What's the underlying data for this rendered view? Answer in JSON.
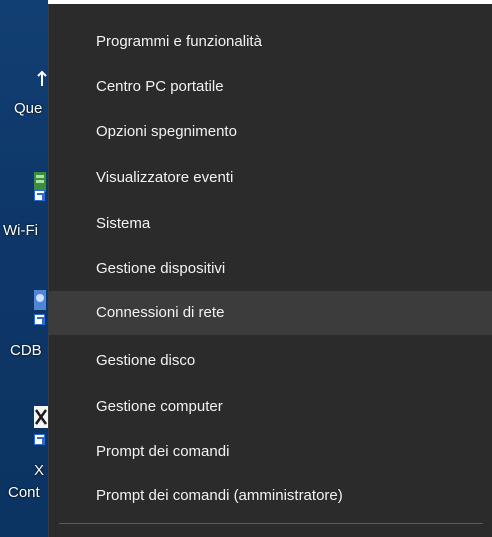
{
  "desktop": {
    "icons": [
      {
        "label": "Que",
        "icon": "arrow-up-icon"
      },
      {
        "label": "Wi-Fi",
        "icon": "wifi-shortcut-icon"
      },
      {
        "label": "CDB",
        "icon": "app-shortcut-icon"
      },
      {
        "label": "X",
        "icon": "document-x-icon"
      },
      {
        "label": "Cont",
        "icon": "shortcut-label"
      }
    ]
  },
  "menu": {
    "items": [
      {
        "label": "Programmi e funzionalità"
      },
      {
        "label": "Centro PC portatile"
      },
      {
        "label": "Opzioni spegnimento"
      },
      {
        "label": "Visualizzatore eventi"
      },
      {
        "label": "Sistema"
      },
      {
        "label": "Gestione dispositivi"
      },
      {
        "label": "Connessioni di rete",
        "state": "hovered"
      },
      {
        "label": "Gestione disco"
      },
      {
        "label": "Gestione computer"
      },
      {
        "label": "Prompt dei comandi"
      },
      {
        "label": "Prompt dei comandi (amministratore)"
      }
    ]
  },
  "colors": {
    "menu_background": "#2b2b2b",
    "menu_hover": "#3c3c3c",
    "menu_text": "#f2f2f2",
    "desktop_background": "#0e3768"
  }
}
